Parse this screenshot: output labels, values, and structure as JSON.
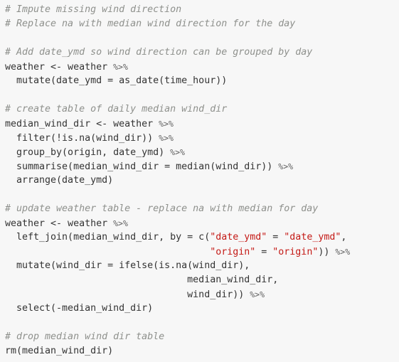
{
  "code": {
    "lines": [
      [
        {
          "t": "# Impute missing wind direction",
          "k": "comment"
        }
      ],
      [
        {
          "t": "# Replace na with median wind direction for the day",
          "k": "comment"
        }
      ],
      [],
      [
        {
          "t": "# Add date_ymd so wind direction can be grouped by day",
          "k": "comment"
        }
      ],
      [
        {
          "t": "weather <- weather ",
          "k": "plain"
        },
        {
          "t": "%>%",
          "k": "op"
        }
      ],
      [
        {
          "t": "  mutate(date_ymd = as_date(time_hour))",
          "k": "plain"
        }
      ],
      [],
      [
        {
          "t": "# create table of daily median wind_dir",
          "k": "comment"
        }
      ],
      [
        {
          "t": "median_wind_dir <- weather ",
          "k": "plain"
        },
        {
          "t": "%>%",
          "k": "op"
        }
      ],
      [
        {
          "t": "  filter(!is.na(wind_dir)) ",
          "k": "plain"
        },
        {
          "t": "%>%",
          "k": "op"
        }
      ],
      [
        {
          "t": "  group_by(origin, date_ymd) ",
          "k": "plain"
        },
        {
          "t": "%>%",
          "k": "op"
        }
      ],
      [
        {
          "t": "  summarise(median_wind_dir = median(wind_dir)) ",
          "k": "plain"
        },
        {
          "t": "%>%",
          "k": "op"
        }
      ],
      [
        {
          "t": "  arrange(date_ymd)",
          "k": "plain"
        }
      ],
      [],
      [
        {
          "t": "# update weather table - replace na with median for day",
          "k": "comment"
        }
      ],
      [
        {
          "t": "weather <- weather ",
          "k": "plain"
        },
        {
          "t": "%>%",
          "k": "op"
        }
      ],
      [
        {
          "t": "  left_join(median_wind_dir, by = c(",
          "k": "plain"
        },
        {
          "t": "\"date_ymd\"",
          "k": "string"
        },
        {
          "t": " = ",
          "k": "plain"
        },
        {
          "t": "\"date_ymd\"",
          "k": "string"
        },
        {
          "t": ",",
          "k": "plain"
        }
      ],
      [
        {
          "t": "                                    ",
          "k": "plain"
        },
        {
          "t": "\"origin\"",
          "k": "string"
        },
        {
          "t": " = ",
          "k": "plain"
        },
        {
          "t": "\"origin\"",
          "k": "string"
        },
        {
          "t": ")) ",
          "k": "plain"
        },
        {
          "t": "%>%",
          "k": "op"
        }
      ],
      [
        {
          "t": "  mutate(wind_dir = ifelse(is.na(wind_dir),",
          "k": "plain"
        }
      ],
      [
        {
          "t": "                                median_wind_dir,",
          "k": "plain"
        }
      ],
      [
        {
          "t": "                                wind_dir)) ",
          "k": "plain"
        },
        {
          "t": "%>%",
          "k": "op"
        }
      ],
      [
        {
          "t": "  select(-median_wind_dir)",
          "k": "plain"
        }
      ],
      [],
      [
        {
          "t": "# drop median wind dir table",
          "k": "comment"
        }
      ],
      [
        {
          "t": "rm(median_wind_dir)",
          "k": "plain"
        }
      ]
    ]
  }
}
